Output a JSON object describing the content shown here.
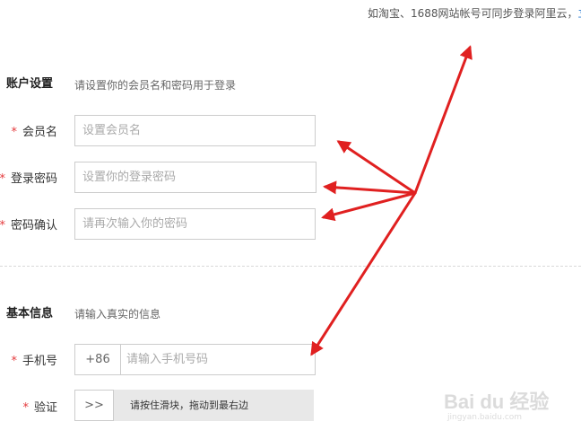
{
  "top_note": {
    "text": "如淘宝、1688网站帐号可同步登录阿里云，",
    "link_text": "立"
  },
  "account_section": {
    "title": "账户设置",
    "hint": "请设置你的会员名和密码用于登录"
  },
  "fields": {
    "member_name": {
      "required_mark": "*",
      "label": "会员名",
      "placeholder": "设置会员名"
    },
    "login_password": {
      "required_mark": "*",
      "label": "登录密码",
      "placeholder": "设置你的登录密码"
    },
    "confirm_password": {
      "required_mark": "*",
      "label": "密码确认",
      "placeholder": "请再次输入你的密码"
    }
  },
  "basic_section": {
    "title": "基本信息",
    "hint": "请输入真实的信息"
  },
  "phone": {
    "required_mark": "*",
    "label": "手机号",
    "country_code": "+86",
    "placeholder": "请输入手机号码"
  },
  "verify": {
    "required_mark": "*",
    "label": "验证",
    "handle_glyph": ">>",
    "slider_text": "请按住滑块，拖动到最右边"
  },
  "watermark": {
    "brand": "Bai du 经验",
    "url": "jingyan.baidu.com"
  },
  "colors": {
    "required": "#e4393c",
    "annotation_arrow": "#e02020",
    "link": "#2a7bd1"
  }
}
